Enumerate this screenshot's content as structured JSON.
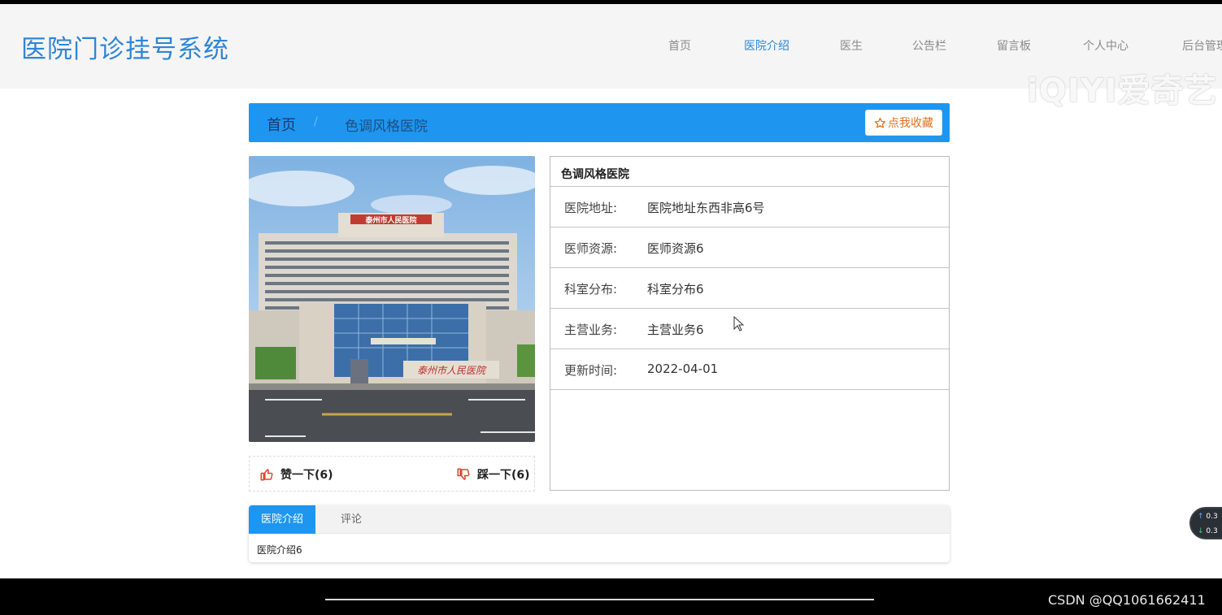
{
  "header": {
    "logo": "医院门诊挂号系统",
    "nav": [
      "首页",
      "医院介绍",
      "医生",
      "公告栏",
      "留言板",
      "个人中心",
      "后台管理"
    ],
    "active_nav": "医院介绍",
    "watermark": "iQIYI爱奇艺"
  },
  "breadcrumb": {
    "home": "首页",
    "separator": "/",
    "current": "色调风格医院",
    "favorite_label": "点我收藏"
  },
  "photo": {
    "sign_top": "泰州市人民医院",
    "sign_gate": "泰州市人民医院"
  },
  "votes": {
    "like_label": "赞一下(6)",
    "dislike_label": "踩一下(6)"
  },
  "info": {
    "title": "色调风格医院",
    "rows": [
      {
        "key": "医院地址:",
        "value": "医院地址东西非高6号"
      },
      {
        "key": "医师资源:",
        "value": "医师资源6"
      },
      {
        "key": "科室分布:",
        "value": "科室分布6"
      },
      {
        "key": "主营业务:",
        "value": "主营业务6"
      },
      {
        "key": "更新时间:",
        "value": "2022-04-01"
      }
    ]
  },
  "tabs": {
    "items": [
      "医院介绍",
      "评论"
    ],
    "active": "医院介绍",
    "content": "医院介绍6"
  },
  "network": {
    "up": "0.3",
    "down": "0.3"
  },
  "footer": {
    "credit": "CSDN @QQ1061662411"
  },
  "colors": {
    "accent": "#1e96f0",
    "logo": "#2f86d6",
    "favorite": "#e07020",
    "vote_icon": "#e0452b"
  }
}
